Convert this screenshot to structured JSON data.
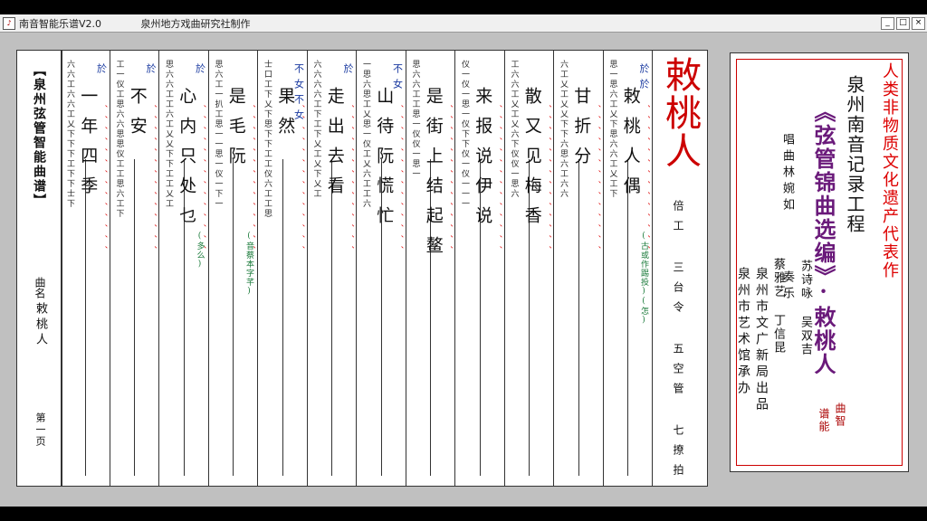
{
  "window": {
    "app_name": "南音智能乐谱V2.0",
    "producer": "泉州地方戏曲研究社制作",
    "controls": {
      "minimize": "_",
      "maximize": "□",
      "close": "×"
    }
  },
  "score": {
    "header": "【泉州弦管智能曲谱】",
    "qu_ming_label": "曲名",
    "song_name": "敕桃人",
    "page": "第一页",
    "title": "敕桃人",
    "meta": "倍工 三台令 五空管 七撩拍",
    "columns": [
      {
        "lyric": "一年四季",
        "notes": "六六工六六工乂下下下工下下士下",
        "blue": "於",
        "green": ""
      },
      {
        "lyric": "不安",
        "notes": "工一仪工思六六思思仪工工思六工下",
        "blue": "於",
        "green": ""
      },
      {
        "lyric": "心内只处乜",
        "notes": "思六六工工六工乂乂下下工工乂工",
        "blue": "於",
        "green": "(多么)"
      },
      {
        "lyric": "是毛阮",
        "notes": "思六工一扒工思一一思一仪一下一",
        "blue": "",
        "green": "(音蔡本字芊)"
      },
      {
        "lyric": "果然",
        "notes": "士口工下乂下思下下工工仪六工工思",
        "blue": "不女不女",
        "green": ""
      },
      {
        "lyric": "走出去看",
        "notes": "六六六六工下工下乂工乂下乂工",
        "blue": "於",
        "green": ""
      },
      {
        "lyric": "山待阮慌忙",
        "notes": "一思六思工乂思一仪工乂六工工六",
        "blue": "不女",
        "green": ""
      },
      {
        "lyric": "是街上结起鳌",
        "notes": "思六六工工思一仪仪一思一",
        "blue": "",
        "green": ""
      },
      {
        "lyric": "来报说伊说",
        "notes": "仪一仪一思一仪下下仪一仪一一一",
        "blue": "",
        "green": ""
      },
      {
        "lyric": "散又见梅香",
        "notes": "工六六工乂工乂六下仪仪一思六",
        "blue": "",
        "green": ""
      },
      {
        "lyric": "甘折分",
        "notes": "六工乂工乂乂下下六思六工六六",
        "blue": "",
        "green": ""
      },
      {
        "lyric": "敕桃人偶",
        "notes": "思一思六工乂下思六六工乂工下",
        "blue": "於於",
        "green": "(古或作踢投)(怎)"
      }
    ]
  },
  "cover": {
    "line1": "人类非物质文化遗产代表作",
    "line2": "泉州南音记录工程",
    "line3": "《弦管锦曲选编》·敕桃人",
    "line4": "唱曲林婉如",
    "line5": "奏乐",
    "line6": "苏诗咏 吴双吉",
    "line7": "蔡雅艺 丁信昆",
    "publisher": "泉州市文广新局出品",
    "organizer": "泉州市艺术馆承办",
    "stamp1": "曲智",
    "stamp2": "谱能"
  },
  "colors": {
    "title_red": "#cc0000",
    "cover_purple": "#6a1a7a",
    "note_blue": "#1a3aa0",
    "note_green": "#1a7a3a",
    "dot_red": "#dd0000",
    "window_bg": "#c0c0c0"
  }
}
